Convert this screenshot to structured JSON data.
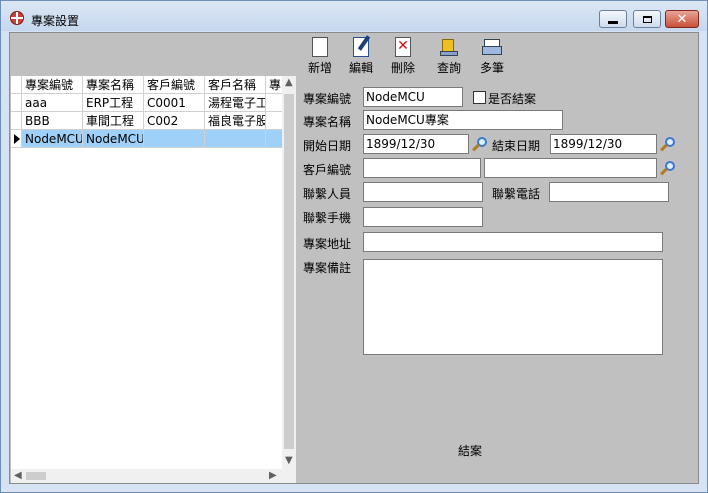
{
  "window": {
    "title": "專案設置"
  },
  "toolbar": {
    "new_label": "新增",
    "edit_label": "編輯",
    "delete_label": "刪除",
    "query_label": "查詢",
    "multi_label": "多筆"
  },
  "grid": {
    "columns": [
      "專案編號",
      "專案名稱",
      "客戶編號",
      "客戶名稱",
      "專"
    ],
    "rows": [
      [
        "aaa",
        "ERP工程",
        "C0001",
        "湯程電子工",
        ""
      ],
      [
        "BBB",
        "車間工程",
        "C002",
        "福良電子股",
        ""
      ],
      [
        "NodeMCU",
        "NodeMCU專",
        "",
        "",
        ""
      ]
    ]
  },
  "form": {
    "project_no_label": "專案編號",
    "project_no_value": "NodeMCU",
    "closed_check_label": "是否結案",
    "project_name_label": "專案名稱",
    "project_name_value": "NodeMCU專案",
    "start_date_label": "開始日期",
    "start_date_value": "1899/12/30",
    "end_date_label": "結束日期",
    "end_date_value": "1899/12/30",
    "customer_no_label": "客戶編號",
    "customer_no_value": "",
    "customer_name_value": "",
    "contact_person_label": "聯繫人員",
    "contact_person_value": "",
    "contact_phone_label": "聯繫電話",
    "contact_phone_value": "",
    "contact_mobile_label": "聯繫手機",
    "contact_mobile_value": "",
    "address_label": "專案地址",
    "address_value": "",
    "remark_label": "專案備註",
    "remark_value": "",
    "close_button_label": "結案"
  }
}
